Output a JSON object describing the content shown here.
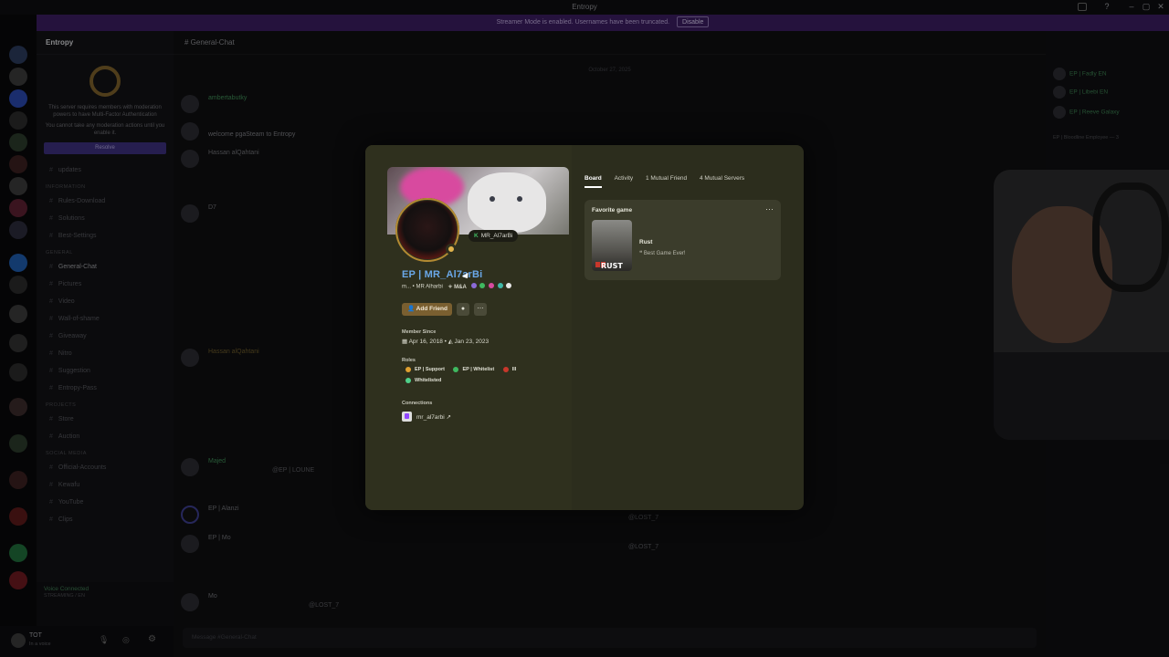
{
  "window": {
    "title": "Entropy"
  },
  "banner": {
    "text": "Streamer Mode is enabled. Usernames have been truncated.",
    "button": "Disable"
  },
  "sidebar": {
    "server_name": "Entropy",
    "mfa_text": "This server requires members with moderation powers to have Multi-Factor Authentication",
    "mfa_sub": "You cannot take any moderation actions until you enable it.",
    "resolve": "Resolve",
    "categories": {
      "information": "Information",
      "general": "General",
      "projects": "Projects",
      "social": "Social Media"
    },
    "channels": [
      "updates",
      "Rules-Download",
      "Solutions",
      "Best-Settings",
      "General-Chat",
      "Pictures",
      "Video",
      "Wall-of-shame",
      "Giveaway",
      "Nitro",
      "Suggestion",
      "Entropy-Pass",
      "Store",
      "Auction",
      "Official-Accounts",
      "Kewafu",
      "YouTube",
      "Clips"
    ],
    "voice_title": "Voice Connected",
    "voice_sub": "STREAMING / EN"
  },
  "user": {
    "name": "TOT",
    "status": "In a voice"
  },
  "chat": {
    "channel": "General-Chat",
    "date_divider": "October 27, 2025",
    "messages": [
      {
        "name": "ambertabutky",
        "body": "welcome pgaSteam to Entropy"
      },
      {
        "name": "Hassan alQahtani",
        "body": ""
      },
      {
        "name": "D7",
        "body": ""
      },
      {
        "name": "Hassan alQahtani",
        "body": ""
      },
      {
        "name": "Majed",
        "body": "@EP | LOUNE"
      },
      {
        "name": "EP | Alanzi",
        "body": "@LOST_7"
      },
      {
        "name": "EP | Mo",
        "body": "@LOST_7"
      },
      {
        "name": "Mo",
        "body": "@LOST_7"
      }
    ],
    "input_placeholder": "Message #General-Chat"
  },
  "members": {
    "items": [
      "EP | Fadly EN",
      "EP | Libebi EN",
      "EP | Reeve Galaxy"
    ],
    "category_staff": "EP | Bloodline Employee — 3"
  },
  "profile": {
    "display_name": "EP | MR_Al7arBi",
    "username": "m...",
    "pronoun_name": "MR Alharbi",
    "tag": "M&A",
    "custom_status": "MR_Al7arBi",
    "add_friend": "Add Friend",
    "member_since_title": "Member Since",
    "discord_since": "Apr 16, 2018",
    "server_since": "Jan 23, 2023",
    "roles_title": "Roles",
    "roles": [
      {
        "name": "EP | Support",
        "color": "#e0a030"
      },
      {
        "name": "EP | Whitelist",
        "color": "#3fb860"
      },
      {
        "name": "III",
        "color": "#c8372b"
      },
      {
        "name": "Whitelisted",
        "color": "#4fd08a"
      }
    ],
    "connections_title": "Connections",
    "connection": "mr_al7arbi ↗",
    "tabs": [
      "Board",
      "Activity",
      "1 Mutual Friend",
      "4 Mutual Servers"
    ],
    "favorite": {
      "title": "Favorite game",
      "game": "Rust",
      "note": "Best Game Ever!",
      "logo": "RUST"
    }
  },
  "icons": {
    "more": "more-icon",
    "message": "message-icon",
    "friend": "add-friend-icon",
    "twitch": "twitch-icon",
    "calendar": "calendar-icon"
  }
}
